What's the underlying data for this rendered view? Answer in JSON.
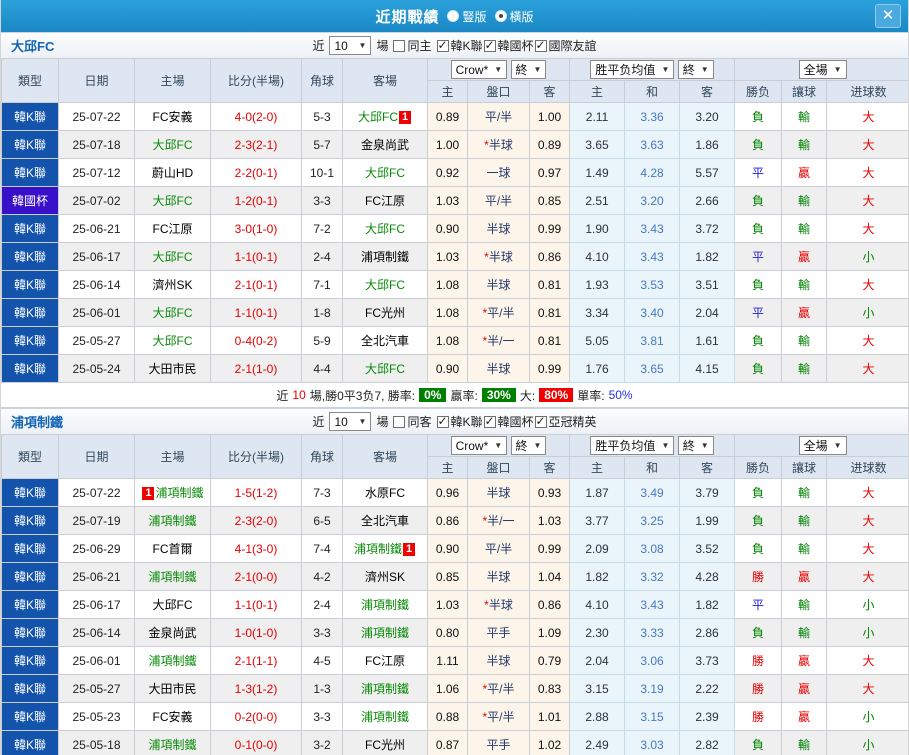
{
  "titlebar": {
    "title": "近期戰績",
    "radios": [
      {
        "label": "豎版",
        "selected": false
      },
      {
        "label": "橫版",
        "selected": true
      }
    ],
    "close_glyph": "✕"
  },
  "filters_common": {
    "recent_label": "近",
    "recent_value": "10",
    "games_label": "場"
  },
  "table": {
    "main_cols": [
      "類型",
      "日期",
      "主場",
      "比分(半場)",
      "角球",
      "客場"
    ],
    "sub_cols": [
      "主",
      "盤口",
      "客",
      "主",
      "和",
      "客",
      "勝负",
      "讓球",
      "进球数"
    ],
    "odds_source": "Crow*",
    "final_label": "終",
    "avg_source": "胜平负均值",
    "scope": "全場"
  },
  "colors": {
    "titlebar_blue": "#1e96d2",
    "league_type_blue": "#1353ac",
    "cup_type_purple": "#3910c9",
    "team_highlight_green": "#088a08",
    "score_red": "#e60000",
    "handicap_column_cream": "#fdf5e9",
    "avg_column_blue": "#eaf4fb",
    "result_lose_green": "#008000",
    "result_draw_blue": "#1f1fd0",
    "badge_green": "#008000",
    "badge_red": "#f00000",
    "row_stripe_gray": "#efefef"
  },
  "sections": [
    {
      "team": "大邱FC",
      "same_label": "同主",
      "same_checked": false,
      "league_filters": [
        {
          "label": "韓K聯",
          "checked": true
        },
        {
          "label": "韓國杯",
          "checked": true
        },
        {
          "label": "國際友誼",
          "checked": true
        }
      ],
      "rows": [
        {
          "type": "韓K聯",
          "cup": false,
          "date": "25-07-22",
          "home": "FC安義",
          "home_hl": false,
          "home_badge": "",
          "home_badge_pos": "",
          "score": "4-0",
          "half": "(2-0)",
          "corner": "5-3",
          "away": "大邱FC",
          "away_hl": true,
          "away_badge": "1",
          "away_badge_pos": "post",
          "o_h": "0.89",
          "star": false,
          "handicap": "平/半",
          "o_a": "1.00",
          "avg_h": "2.11",
          "avg_d": "3.36",
          "avg_a": "3.20",
          "wdl": "負",
          "wdl_c": "g",
          "hcp": "輸",
          "hcp_c": "g",
          "goal": "大",
          "goal_c": "r"
        },
        {
          "type": "韓K聯",
          "cup": false,
          "date": "25-07-18",
          "home": "大邱FC",
          "home_hl": true,
          "home_badge": "",
          "home_badge_pos": "",
          "score": "2-3",
          "half": "(2-1)",
          "corner": "5-7",
          "away": "金泉尚武",
          "away_hl": false,
          "away_badge": "",
          "away_badge_pos": "",
          "o_h": "1.00",
          "star": true,
          "handicap": "半球",
          "o_a": "0.89",
          "avg_h": "3.65",
          "avg_d": "3.63",
          "avg_a": "1.86",
          "wdl": "負",
          "wdl_c": "g",
          "hcp": "輸",
          "hcp_c": "g",
          "goal": "大",
          "goal_c": "r"
        },
        {
          "type": "韓K聯",
          "cup": false,
          "date": "25-07-12",
          "home": "蔚山HD",
          "home_hl": false,
          "home_badge": "",
          "home_badge_pos": "",
          "score": "2-2",
          "half": "(0-1)",
          "corner": "10-1",
          "away": "大邱FC",
          "away_hl": true,
          "away_badge": "",
          "away_badge_pos": "",
          "o_h": "0.92",
          "star": false,
          "handicap": "一球",
          "o_a": "0.97",
          "avg_h": "1.49",
          "avg_d": "4.28",
          "avg_a": "5.57",
          "wdl": "平",
          "wdl_c": "b",
          "hcp": "贏",
          "hcp_c": "r",
          "goal": "大",
          "goal_c": "r"
        },
        {
          "type": "韓國杯",
          "cup": true,
          "date": "25-07-02",
          "home": "大邱FC",
          "home_hl": true,
          "home_badge": "",
          "home_badge_pos": "",
          "score": "1-2",
          "half": "(0-1)",
          "corner": "3-3",
          "away": "FC江原",
          "away_hl": false,
          "away_badge": "",
          "away_badge_pos": "",
          "o_h": "1.03",
          "star": false,
          "handicap": "平/半",
          "o_a": "0.85",
          "avg_h": "2.51",
          "avg_d": "3.20",
          "avg_a": "2.66",
          "wdl": "負",
          "wdl_c": "g",
          "hcp": "輸",
          "hcp_c": "g",
          "goal": "大",
          "goal_c": "r"
        },
        {
          "type": "韓K聯",
          "cup": false,
          "date": "25-06-21",
          "home": "FC江原",
          "home_hl": false,
          "home_badge": "",
          "home_badge_pos": "",
          "score": "3-0",
          "half": "(1-0)",
          "corner": "7-2",
          "away": "大邱FC",
          "away_hl": true,
          "away_badge": "",
          "away_badge_pos": "",
          "o_h": "0.90",
          "star": false,
          "handicap": "半球",
          "o_a": "0.99",
          "avg_h": "1.90",
          "avg_d": "3.43",
          "avg_a": "3.72",
          "wdl": "負",
          "wdl_c": "g",
          "hcp": "輸",
          "hcp_c": "g",
          "goal": "大",
          "goal_c": "r"
        },
        {
          "type": "韓K聯",
          "cup": false,
          "date": "25-06-17",
          "home": "大邱FC",
          "home_hl": true,
          "home_badge": "",
          "home_badge_pos": "",
          "score": "1-1",
          "half": "(0-1)",
          "corner": "2-4",
          "away": "浦項制鐵",
          "away_hl": false,
          "away_badge": "",
          "away_badge_pos": "",
          "o_h": "1.03",
          "star": true,
          "handicap": "半球",
          "o_a": "0.86",
          "avg_h": "4.10",
          "avg_d": "3.43",
          "avg_a": "1.82",
          "wdl": "平",
          "wdl_c": "b",
          "hcp": "贏",
          "hcp_c": "r",
          "goal": "小",
          "goal_c": "g"
        },
        {
          "type": "韓K聯",
          "cup": false,
          "date": "25-06-14",
          "home": "濟州SK",
          "home_hl": false,
          "home_badge": "",
          "home_badge_pos": "",
          "score": "2-1",
          "half": "(0-1)",
          "corner": "7-1",
          "away": "大邱FC",
          "away_hl": true,
          "away_badge": "",
          "away_badge_pos": "",
          "o_h": "1.08",
          "star": false,
          "handicap": "半球",
          "o_a": "0.81",
          "avg_h": "1.93",
          "avg_d": "3.53",
          "avg_a": "3.51",
          "wdl": "負",
          "wdl_c": "g",
          "hcp": "輸",
          "hcp_c": "g",
          "goal": "大",
          "goal_c": "r"
        },
        {
          "type": "韓K聯",
          "cup": false,
          "date": "25-06-01",
          "home": "大邱FC",
          "home_hl": true,
          "home_badge": "",
          "home_badge_pos": "",
          "score": "1-1",
          "half": "(0-1)",
          "corner": "1-8",
          "away": "FC光州",
          "away_hl": false,
          "away_badge": "",
          "away_badge_pos": "",
          "o_h": "1.08",
          "star": true,
          "handicap": "平/半",
          "o_a": "0.81",
          "avg_h": "3.34",
          "avg_d": "3.40",
          "avg_a": "2.04",
          "wdl": "平",
          "wdl_c": "b",
          "hcp": "贏",
          "hcp_c": "r",
          "goal": "小",
          "goal_c": "g"
        },
        {
          "type": "韓K聯",
          "cup": false,
          "date": "25-05-27",
          "home": "大邱FC",
          "home_hl": true,
          "home_badge": "",
          "home_badge_pos": "",
          "score": "0-4",
          "half": "(0-2)",
          "corner": "5-9",
          "away": "全北汽車",
          "away_hl": false,
          "away_badge": "",
          "away_badge_pos": "",
          "o_h": "1.08",
          "star": true,
          "handicap": "半/一",
          "o_a": "0.81",
          "avg_h": "5.05",
          "avg_d": "3.81",
          "avg_a": "1.61",
          "wdl": "負",
          "wdl_c": "g",
          "hcp": "輸",
          "hcp_c": "g",
          "goal": "大",
          "goal_c": "r"
        },
        {
          "type": "韓K聯",
          "cup": false,
          "date": "25-05-24",
          "home": "大田市民",
          "home_hl": false,
          "home_badge": "",
          "home_badge_pos": "",
          "score": "2-1",
          "half": "(1-0)",
          "corner": "4-4",
          "away": "大邱FC",
          "away_hl": true,
          "away_badge": "",
          "away_badge_pos": "",
          "o_h": "0.90",
          "star": false,
          "handicap": "半球",
          "o_a": "0.99",
          "avg_h": "1.76",
          "avg_d": "3.65",
          "avg_a": "4.15",
          "wdl": "負",
          "wdl_c": "g",
          "hcp": "輸",
          "hcp_c": "g",
          "goal": "大",
          "goal_c": "r"
        }
      ],
      "summary": {
        "prefix": "近",
        "count": "10",
        "record": "場,勝0平3负7, 勝率:",
        "win_pct": "0%",
        "cover_label": "贏率:",
        "cover_pct": "30%",
        "big_label": "大:",
        "big_pct": "80%",
        "single_label": "單率:",
        "single_pct": "50%"
      }
    },
    {
      "team": "浦項制鐵",
      "same_label": "同客",
      "same_checked": false,
      "league_filters": [
        {
          "label": "韓K聯",
          "checked": true
        },
        {
          "label": "韓國杯",
          "checked": true
        },
        {
          "label": "亞冠精英",
          "checked": true
        }
      ],
      "rows": [
        {
          "type": "韓K聯",
          "cup": false,
          "date": "25-07-22",
          "home": "浦項制鐵",
          "home_hl": true,
          "home_badge": "1",
          "home_badge_pos": "pre",
          "score": "1-5",
          "half": "(1-2)",
          "corner": "7-3",
          "away": "水原FC",
          "away_hl": false,
          "away_badge": "",
          "away_badge_pos": "",
          "o_h": "0.96",
          "star": false,
          "handicap": "半球",
          "o_a": "0.93",
          "avg_h": "1.87",
          "avg_d": "3.49",
          "avg_a": "3.79",
          "wdl": "負",
          "wdl_c": "g",
          "hcp": "輸",
          "hcp_c": "g",
          "goal": "大",
          "goal_c": "r"
        },
        {
          "type": "韓K聯",
          "cup": false,
          "date": "25-07-19",
          "home": "浦項制鐵",
          "home_hl": true,
          "home_badge": "",
          "home_badge_pos": "",
          "score": "2-3",
          "half": "(2-0)",
          "corner": "6-5",
          "away": "全北汽車",
          "away_hl": false,
          "away_badge": "",
          "away_badge_pos": "",
          "o_h": "0.86",
          "star": true,
          "handicap": "半/一",
          "o_a": "1.03",
          "avg_h": "3.77",
          "avg_d": "3.25",
          "avg_a": "1.99",
          "wdl": "負",
          "wdl_c": "g",
          "hcp": "輸",
          "hcp_c": "g",
          "goal": "大",
          "goal_c": "r"
        },
        {
          "type": "韓K聯",
          "cup": false,
          "date": "25-06-29",
          "home": "FC首爾",
          "home_hl": false,
          "home_badge": "",
          "home_badge_pos": "",
          "score": "4-1",
          "half": "(3-0)",
          "corner": "7-4",
          "away": "浦項制鐵",
          "away_hl": true,
          "away_badge": "1",
          "away_badge_pos": "post",
          "o_h": "0.90",
          "star": false,
          "handicap": "平/半",
          "o_a": "0.99",
          "avg_h": "2.09",
          "avg_d": "3.08",
          "avg_a": "3.52",
          "wdl": "負",
          "wdl_c": "g",
          "hcp": "輸",
          "hcp_c": "g",
          "goal": "大",
          "goal_c": "r"
        },
        {
          "type": "韓K聯",
          "cup": false,
          "date": "25-06-21",
          "home": "浦項制鐵",
          "home_hl": true,
          "home_badge": "",
          "home_badge_pos": "",
          "score": "2-1",
          "half": "(0-0)",
          "corner": "4-2",
          "away": "濟州SK",
          "away_hl": false,
          "away_badge": "",
          "away_badge_pos": "",
          "o_h": "0.85",
          "star": false,
          "handicap": "半球",
          "o_a": "1.04",
          "avg_h": "1.82",
          "avg_d": "3.32",
          "avg_a": "4.28",
          "wdl": "勝",
          "wdl_c": "r",
          "hcp": "贏",
          "hcp_c": "r",
          "goal": "大",
          "goal_c": "r"
        },
        {
          "type": "韓K聯",
          "cup": false,
          "date": "25-06-17",
          "home": "大邱FC",
          "home_hl": false,
          "home_badge": "",
          "home_badge_pos": "",
          "score": "1-1",
          "half": "(0-1)",
          "corner": "2-4",
          "away": "浦項制鐵",
          "away_hl": true,
          "away_badge": "",
          "away_badge_pos": "",
          "o_h": "1.03",
          "star": true,
          "handicap": "半球",
          "o_a": "0.86",
          "avg_h": "4.10",
          "avg_d": "3.43",
          "avg_a": "1.82",
          "wdl": "平",
          "wdl_c": "b",
          "hcp": "輸",
          "hcp_c": "g",
          "goal": "小",
          "goal_c": "g"
        },
        {
          "type": "韓K聯",
          "cup": false,
          "date": "25-06-14",
          "home": "金泉尚武",
          "home_hl": false,
          "home_badge": "",
          "home_badge_pos": "",
          "score": "1-0",
          "half": "(1-0)",
          "corner": "3-3",
          "away": "浦項制鐵",
          "away_hl": true,
          "away_badge": "",
          "away_badge_pos": "",
          "o_h": "0.80",
          "star": false,
          "handicap": "平手",
          "o_a": "1.09",
          "avg_h": "2.30",
          "avg_d": "3.33",
          "avg_a": "2.86",
          "wdl": "負",
          "wdl_c": "g",
          "hcp": "輸",
          "hcp_c": "g",
          "goal": "小",
          "goal_c": "g"
        },
        {
          "type": "韓K聯",
          "cup": false,
          "date": "25-06-01",
          "home": "浦項制鐵",
          "home_hl": true,
          "home_badge": "",
          "home_badge_pos": "",
          "score": "2-1",
          "half": "(1-1)",
          "corner": "4-5",
          "away": "FC江原",
          "away_hl": false,
          "away_badge": "",
          "away_badge_pos": "",
          "o_h": "1.11",
          "star": false,
          "handicap": "半球",
          "o_a": "0.79",
          "avg_h": "2.04",
          "avg_d": "3.06",
          "avg_a": "3.73",
          "wdl": "勝",
          "wdl_c": "r",
          "hcp": "贏",
          "hcp_c": "r",
          "goal": "大",
          "goal_c": "r"
        },
        {
          "type": "韓K聯",
          "cup": false,
          "date": "25-05-27",
          "home": "大田市民",
          "home_hl": false,
          "home_badge": "",
          "home_badge_pos": "",
          "score": "1-3",
          "half": "(1-2)",
          "corner": "1-3",
          "away": "浦項制鐵",
          "away_hl": true,
          "away_badge": "",
          "away_badge_pos": "",
          "o_h": "1.06",
          "star": true,
          "handicap": "平/半",
          "o_a": "0.83",
          "avg_h": "3.15",
          "avg_d": "3.19",
          "avg_a": "2.22",
          "wdl": "勝",
          "wdl_c": "r",
          "hcp": "贏",
          "hcp_c": "r",
          "goal": "大",
          "goal_c": "r"
        },
        {
          "type": "韓K聯",
          "cup": false,
          "date": "25-05-23",
          "home": "FC安義",
          "home_hl": false,
          "home_badge": "",
          "home_badge_pos": "",
          "score": "0-2",
          "half": "(0-0)",
          "corner": "3-3",
          "away": "浦項制鐵",
          "away_hl": true,
          "away_badge": "",
          "away_badge_pos": "",
          "o_h": "0.88",
          "star": true,
          "handicap": "平/半",
          "o_a": "1.01",
          "avg_h": "2.88",
          "avg_d": "3.15",
          "avg_a": "2.39",
          "wdl": "勝",
          "wdl_c": "r",
          "hcp": "贏",
          "hcp_c": "r",
          "goal": "小",
          "goal_c": "g"
        },
        {
          "type": "韓K聯",
          "cup": false,
          "date": "25-05-18",
          "home": "浦項制鐵",
          "home_hl": true,
          "home_badge": "",
          "home_badge_pos": "",
          "score": "0-1",
          "half": "(0-0)",
          "corner": "3-2",
          "away": "FC光州",
          "away_hl": false,
          "away_badge": "",
          "away_badge_pos": "",
          "o_h": "0.87",
          "star": false,
          "handicap": "平手",
          "o_a": "1.02",
          "avg_h": "2.49",
          "avg_d": "3.03",
          "avg_a": "2.82",
          "wdl": "負",
          "wdl_c": "g",
          "hcp": "輸",
          "hcp_c": "g",
          "goal": "小",
          "goal_c": "g"
        }
      ],
      "summary": null
    }
  ]
}
